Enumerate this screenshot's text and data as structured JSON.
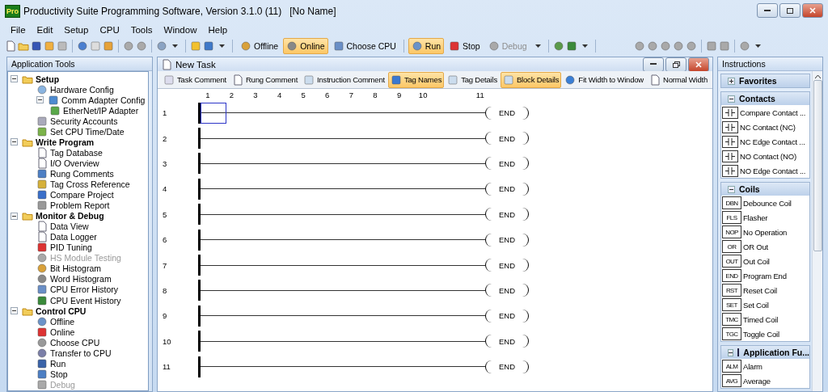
{
  "window": {
    "title": "Productivity Suite Programming Software, Version 3.1.0 (11)   [No Name]",
    "logo": "Pro"
  },
  "menu": [
    "File",
    "Edit",
    "Setup",
    "CPU",
    "Tools",
    "Window",
    "Help"
  ],
  "toolbar": {
    "buttons": [
      {
        "label": "Offline",
        "selected": false,
        "disabled": false
      },
      {
        "label": "Online",
        "selected": true,
        "disabled": false
      },
      {
        "label": "Choose CPU",
        "selected": false,
        "disabled": false
      },
      {
        "label": "Run",
        "selected": true,
        "disabled": false
      },
      {
        "label": "Stop",
        "selected": false,
        "disabled": false
      },
      {
        "label": "Debug",
        "selected": false,
        "disabled": true
      }
    ]
  },
  "application_tools": {
    "title": "Application Tools",
    "tree": [
      {
        "label": "Setup",
        "expanded": true,
        "children": [
          {
            "label": "Hardware Config",
            "disabled": false
          },
          {
            "label": "Comm Adapter Config",
            "disabled": false,
            "expanded": true,
            "children": [
              {
                "label": "EtherNet/IP Adapter",
                "disabled": false
              }
            ]
          },
          {
            "label": "Security Accounts",
            "disabled": false
          },
          {
            "label": "Set CPU Time/Date",
            "disabled": false
          }
        ]
      },
      {
        "label": "Write Program",
        "expanded": true,
        "children": [
          {
            "label": "Tag Database",
            "disabled": false
          },
          {
            "label": "I/O Overview",
            "disabled": false
          },
          {
            "label": "Rung Comments",
            "disabled": false
          },
          {
            "label": "Tag Cross Reference",
            "disabled": false
          },
          {
            "label": "Compare Project",
            "disabled": false
          },
          {
            "label": "Problem Report",
            "disabled": false
          }
        ]
      },
      {
        "label": "Monitor & Debug",
        "expanded": true,
        "children": [
          {
            "label": "Data View",
            "disabled": false
          },
          {
            "label": "Data Logger",
            "disabled": false
          },
          {
            "label": "PID Tuning",
            "disabled": false
          },
          {
            "label": "HS Module Testing",
            "disabled": true
          },
          {
            "label": "Bit Histogram",
            "disabled": false
          },
          {
            "label": "Word Histogram",
            "disabled": false
          },
          {
            "label": "CPU Error History",
            "disabled": false
          },
          {
            "label": "CPU Event History",
            "disabled": false
          }
        ]
      },
      {
        "label": "Control CPU",
        "expanded": true,
        "children": [
          {
            "label": "Offline",
            "disabled": false
          },
          {
            "label": "Online",
            "disabled": false
          },
          {
            "label": "Choose CPU",
            "disabled": false
          },
          {
            "label": "Transfer to CPU",
            "disabled": false
          },
          {
            "label": "Run",
            "disabled": false
          },
          {
            "label": "Stop",
            "disabled": false
          },
          {
            "label": "Debug",
            "disabled": true
          }
        ]
      }
    ]
  },
  "task": {
    "title": "New Task",
    "toolbar": [
      {
        "label": "Task Comment",
        "selected": false
      },
      {
        "label": "Rung Comment",
        "selected": false
      },
      {
        "label": "Instruction Comment",
        "selected": false
      },
      {
        "label": "Tag Names",
        "selected": true
      },
      {
        "label": "Tag Details",
        "selected": false
      },
      {
        "label": "Block Details",
        "selected": true
      },
      {
        "label": "Fit Width to Window",
        "selected": false
      },
      {
        "label": "Normal Width",
        "selected": false
      }
    ],
    "columns": [
      "1",
      "2",
      "3",
      "4",
      "5",
      "6",
      "7",
      "8",
      "9",
      "10",
      "11"
    ],
    "rungs": [
      {
        "number": "1",
        "coil": "END",
        "cursor": true
      },
      {
        "number": "2",
        "coil": "END",
        "cursor": false
      },
      {
        "number": "3",
        "coil": "END",
        "cursor": false
      },
      {
        "number": "4",
        "coil": "END",
        "cursor": false
      },
      {
        "number": "5",
        "coil": "END",
        "cursor": false
      },
      {
        "number": "6",
        "coil": "END",
        "cursor": false
      },
      {
        "number": "7",
        "coil": "END",
        "cursor": false
      },
      {
        "number": "8",
        "coil": "END",
        "cursor": false
      },
      {
        "number": "9",
        "coil": "END",
        "cursor": false
      },
      {
        "number": "10",
        "coil": "END",
        "cursor": false
      },
      {
        "number": "11",
        "coil": "END",
        "cursor": false
      }
    ]
  },
  "instructions": {
    "title": "Instructions",
    "sections": [
      {
        "label": "Favorites",
        "expanded": false,
        "checkbox": false
      },
      {
        "label": "Contacts",
        "expanded": true,
        "checkbox": false,
        "items": [
          {
            "label": "Compare Contact ...",
            "kind": "contact"
          },
          {
            "label": "NC Contact  (NC)",
            "kind": "contact"
          },
          {
            "label": "NC Edge Contact ...",
            "kind": "contact"
          },
          {
            "label": "NO Contact  (NO)",
            "kind": "contact"
          },
          {
            "label": "NO Edge Contact ...",
            "kind": "contact"
          }
        ]
      },
      {
        "label": "Coils",
        "expanded": true,
        "checkbox": false,
        "items": [
          {
            "label": "Debounce Coil",
            "kind": "coil",
            "code": "DBN"
          },
          {
            "label": "Flasher",
            "kind": "coil",
            "code": "FLS"
          },
          {
            "label": "No Operation",
            "kind": "coil",
            "code": "NOP"
          },
          {
            "label": "OR Out",
            "kind": "coil",
            "code": "OR"
          },
          {
            "label": "Out Coil",
            "kind": "coil",
            "code": "OUT"
          },
          {
            "label": "Program End",
            "kind": "coil",
            "code": "END"
          },
          {
            "label": "Reset Coil",
            "kind": "coil",
            "code": "RST"
          },
          {
            "label": "Set Coil",
            "kind": "coil",
            "code": "SET"
          },
          {
            "label": "Timed Coil",
            "kind": "coil",
            "code": "TMC"
          },
          {
            "label": "Toggle Coil",
            "kind": "coil",
            "code": "TGC"
          }
        ]
      },
      {
        "label": "Application Fu...",
        "expanded": true,
        "checkbox": true,
        "items": [
          {
            "label": "Alarm",
            "kind": "function",
            "code": "ALM"
          },
          {
            "label": "Average",
            "kind": "function",
            "code": "AVG"
          }
        ]
      }
    ]
  }
}
